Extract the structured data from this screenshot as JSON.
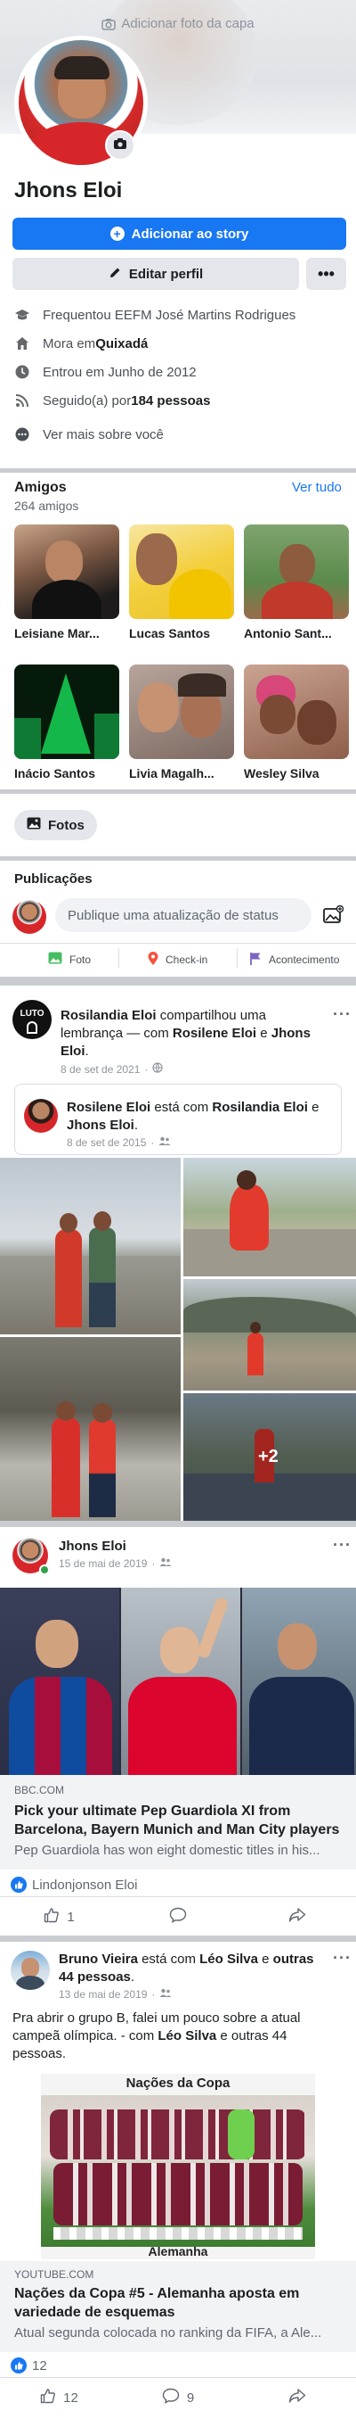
{
  "profile": {
    "cover_action": "Adicionar foto da capa",
    "name": "Jhons Eloi",
    "add_story": "Adicionar ao story",
    "edit_profile": "Editar perfil",
    "more": "•••",
    "info": [
      {
        "icon": "graduation-cap-icon",
        "prefix": "Frequentou ",
        "bold": "",
        "text": "EEFM José Martins Rodrigues"
      },
      {
        "icon": "home-icon",
        "prefix": "Mora em ",
        "bold": "Quixadá",
        "text": ""
      },
      {
        "icon": "clock-icon",
        "prefix": "Entrou em Junho de 2012",
        "bold": "",
        "text": ""
      },
      {
        "icon": "rss-icon",
        "prefix": "Seguido(a) por ",
        "bold": "184 pessoas",
        "text": ""
      },
      {
        "icon": "more-circle-icon",
        "prefix": "Ver mais sobre você",
        "bold": "",
        "text": ""
      }
    ]
  },
  "friends": {
    "title": "Amigos",
    "count": "264 amigos",
    "see_all": "Ver tudo",
    "items": [
      {
        "name": "Leisiane Mar..."
      },
      {
        "name": "Lucas Santos"
      },
      {
        "name": "Antonio Sant..."
      },
      {
        "name": "Inácio Santos"
      },
      {
        "name": "Livia Magalh..."
      },
      {
        "name": "Wesley Silva"
      }
    ]
  },
  "photos_button": "Fotos",
  "composer": {
    "title": "Publicações",
    "placeholder": "Publique uma atualização de status",
    "photo": "Foto",
    "checkin": "Check-in",
    "event": "Acontecimento"
  },
  "post1": {
    "author": "Rosilandia Eloi",
    "action": " compartilhou uma lembrança — com ",
    "with1": "Rosilene Eloi",
    "and": " e ",
    "with2": "Jhons Eloi",
    "period": ".",
    "date": "8 de set de 2021",
    "badge": "LUTO",
    "inner": {
      "author": "Rosilene Eloi",
      "action": " está com ",
      "with1": "Rosilandia Eloi",
      "and": " e ",
      "with2": "Jhons Eloi",
      "period": ".",
      "date": "8 de set de 2015"
    },
    "more_photos": "+2"
  },
  "post2": {
    "author": "Jhons Eloi",
    "date": "15 de mai de 2019",
    "link_source": "BBC.COM",
    "link_title": "Pick your ultimate Pep Guardiola XI from Barcelona, Bayern Munich and Man City players",
    "link_desc": "Pep Guardiola has won eight domestic titles in his...",
    "likers": "Lindonjonson Eloi",
    "like_count": "1"
  },
  "post3": {
    "author": "Bruno Vieira",
    "action": " está com ",
    "with1": "Léo Silva",
    "and": " e ",
    "with2": "outras 44 pessoas",
    "period": ".",
    "date": "13 de mai de 2019",
    "body_pre": "Pra abrir o grupo B, falei um pouco sobre a atual campeã olímpica. - com ",
    "body_b1": "Léo Silva",
    "body_mid": " e outras 44 pessoas.",
    "image_caption_top": "Nações da Copa",
    "image_caption_bottom": "Alemanha",
    "link_source": "YOUTUBE.COM",
    "link_title": "Nações da Copa #5 - Alemanha aposta em variedade de esquemas",
    "link_desc": "Atual segunda colocada no ranking da FIFA, a Ale...",
    "reaction_count": "12",
    "like_count": "12",
    "comment_count": "9"
  },
  "colors": {
    "accent": "#1877f2",
    "background": "#c9ccd1"
  }
}
